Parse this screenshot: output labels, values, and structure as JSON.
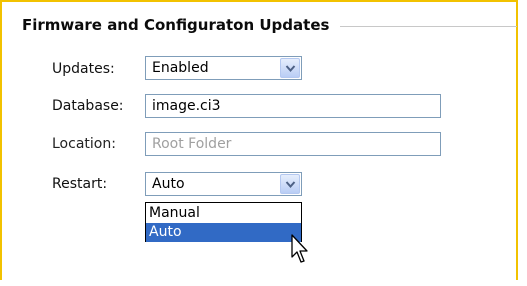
{
  "group": {
    "title": "Firmware and Configuraton Updates"
  },
  "fields": {
    "updates": {
      "label": "Updates:",
      "value": "Enabled"
    },
    "database": {
      "label": "Database:",
      "value": "image.ci3"
    },
    "location": {
      "label": "Location:",
      "placeholder": "Root Folder"
    },
    "restart": {
      "label": "Restart:",
      "value": "Auto",
      "options": [
        "Manual",
        "Auto"
      ],
      "highlighted_option": "Auto"
    }
  },
  "colors": {
    "frame_accent": "#f2c200",
    "selection": "#316ac5",
    "input_border": "#7f9db9"
  },
  "icons": {
    "dropdown": "chevron-down-icon",
    "cursor": "mouse-pointer-icon"
  }
}
